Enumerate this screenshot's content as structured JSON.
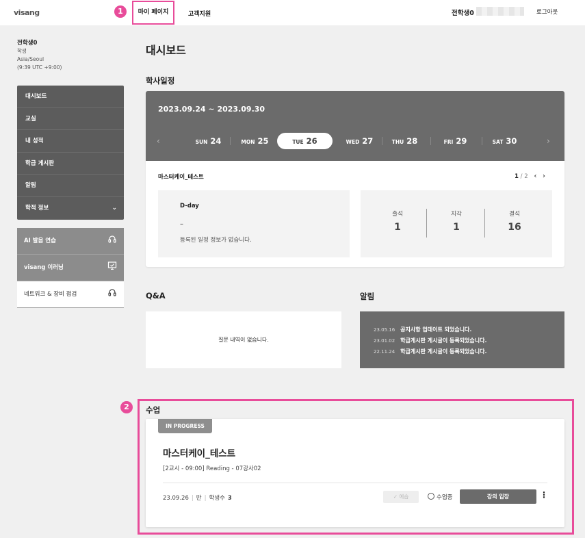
{
  "header": {
    "logo": "visang",
    "nav": [
      "마이 페이지",
      "고객지원"
    ],
    "user_name": "전학생0",
    "logout": "로그아웃",
    "callout_1": "1",
    "callout_2": "2"
  },
  "profile": {
    "name": "전학생0",
    "role": "학생",
    "timezone": "Asia/Seoul",
    "time": "(9:39 UTC +9:00)"
  },
  "sidebar": {
    "items": [
      "대시보드",
      "교실",
      "내 성적",
      "학급 게시판",
      "알림",
      "학적 정보"
    ],
    "extras": [
      "AI 발음 연습",
      "visang 이러닝",
      "네트워크 & 장비 점검"
    ]
  },
  "page_title": "대시보드",
  "schedule": {
    "title": "학사일정",
    "range": "2023.09.24 ~ 2023.09.30",
    "days": [
      {
        "name": "SUN",
        "date": "24"
      },
      {
        "name": "MON",
        "date": "25"
      },
      {
        "name": "TUE",
        "date": "26"
      },
      {
        "name": "WED",
        "date": "27"
      },
      {
        "name": "THU",
        "date": "28"
      },
      {
        "name": "FRI",
        "date": "29"
      },
      {
        "name": "SAT",
        "date": "30"
      }
    ],
    "active_index": 2,
    "course": "마스터케이_테스트",
    "page_current": "1",
    "page_total": "/ 2",
    "dday_label": "D-day",
    "dday_value": "–",
    "dday_message": "등록된 일정 정보가 없습니다.",
    "attendance": [
      {
        "label": "출석",
        "value": "1"
      },
      {
        "label": "지각",
        "value": "1"
      },
      {
        "label": "결석",
        "value": "16"
      }
    ]
  },
  "qa": {
    "title": "Q&A",
    "empty": "질문 내역이 없습니다."
  },
  "notices": {
    "title": "알림",
    "items": [
      {
        "date": "23.05.16",
        "text": "공지사항 업데이트 되었습니다."
      },
      {
        "date": "23.01.02",
        "text": "학급게시판 게시글이 등록되었습니다."
      },
      {
        "date": "22.11.24",
        "text": "학급게시판 게시글이 등록되었습니다."
      }
    ]
  },
  "classes": {
    "title": "수업",
    "tag": "IN PROGRESS",
    "name": "마스터케이_테스트",
    "subtitle": "[2교시 - 09:00]  Reading - 07강사02",
    "date": "23.09.26",
    "section": "반",
    "students_label": "학생수",
    "students": "3",
    "review": "✓ 예습",
    "status": "수업중",
    "enter": "강의 입장",
    "more": "⋮"
  }
}
